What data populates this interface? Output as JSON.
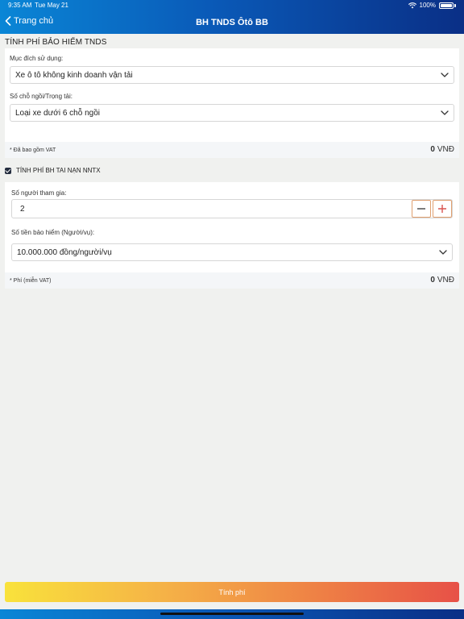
{
  "status_bar": {
    "time": "9:35 AM",
    "date": "Tue May 21",
    "battery": "100%"
  },
  "nav": {
    "back_label": "Trang chủ",
    "title": "BH TNDS Ôtô BB"
  },
  "tnds": {
    "header": "TÍNH PHÍ BẢO HIỂM TNDS",
    "purpose_label": "Mục đích sử dụng:",
    "purpose_value": "Xe ô tô không kinh doanh vận tải",
    "seats_label": "Số chỗ ngồi/Trọng tải:",
    "seats_value": "Loại xe dưới 6 chỗ ngồi",
    "fee_note": "* Đã bao gồm VAT",
    "fee_amount": "0",
    "fee_currency": "VNĐ"
  },
  "accident": {
    "checkbox_label": "TÍNH PHÍ BH TAI NẠN NNTX",
    "checked": true,
    "participants_label": "Số người tham gia:",
    "participants_value": "2",
    "insured_label": "Số tiền bảo hiểm (Người/vụ):",
    "insured_value": "10.000.000 đồng/người/vụ",
    "fee_note": "* Phí (miễn VAT)",
    "fee_amount": "0",
    "fee_currency": "VNĐ"
  },
  "submit_label": "Tính phí",
  "colors": {
    "accent_minus_plus": "#e0a070",
    "plus_icon": "#d9534f",
    "nav_blue": "#0a5ab8"
  }
}
